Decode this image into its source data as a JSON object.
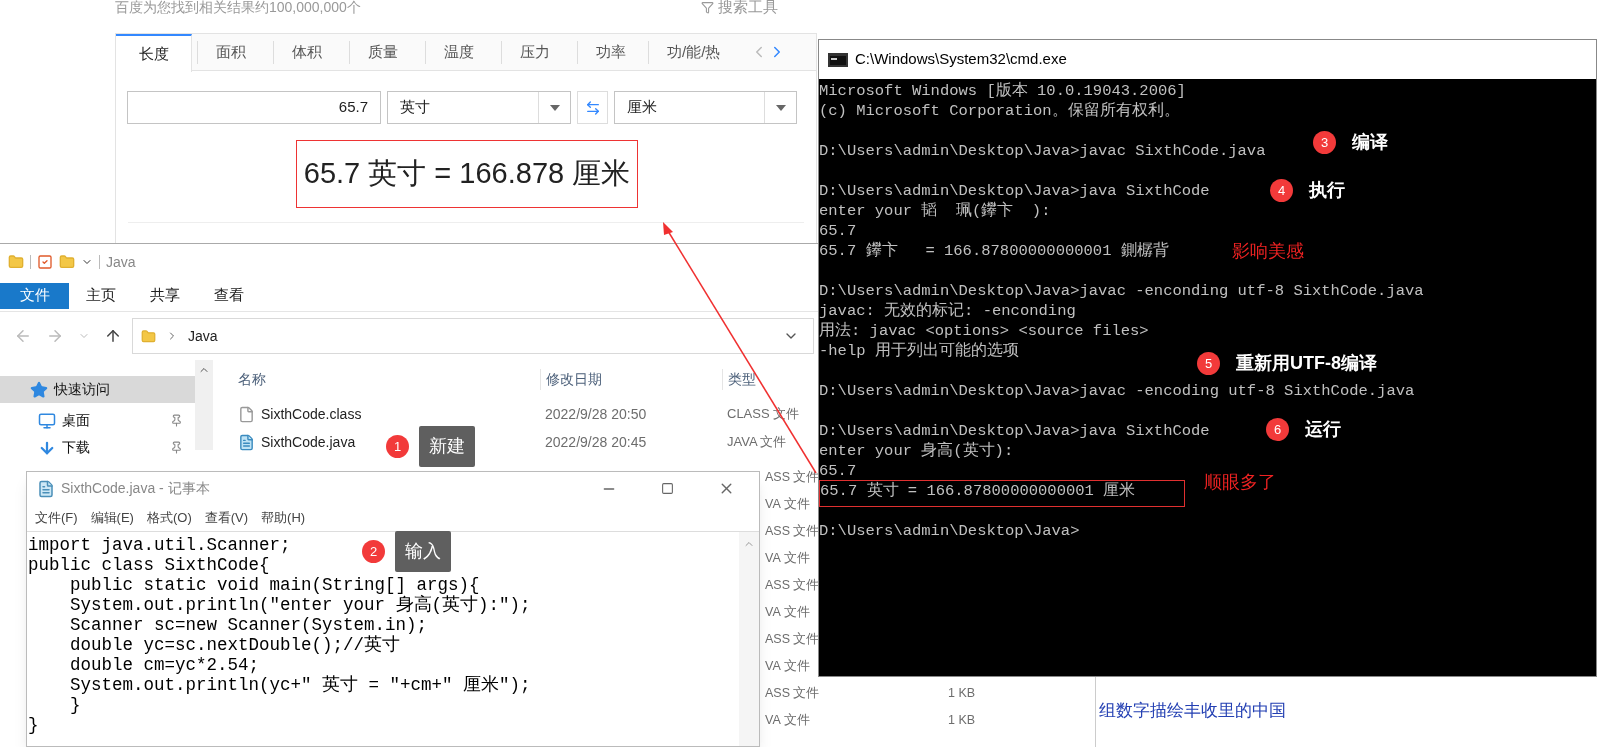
{
  "search_page": {
    "result_count": "百度为您找到相关结果约100,000,000个",
    "search_tools": "搜索工具",
    "converter": {
      "tabs": [
        {
          "label": "长度",
          "selected": true
        },
        {
          "label": "面积",
          "selected": false
        },
        {
          "label": "体积",
          "selected": false
        },
        {
          "label": "质量",
          "selected": false
        },
        {
          "label": "温度",
          "selected": false
        },
        {
          "label": "压力",
          "selected": false
        },
        {
          "label": "功率",
          "selected": false
        },
        {
          "label": "功/能/热",
          "selected": false
        }
      ],
      "value": "65.7",
      "from_unit": "英寸",
      "to_unit": "厘米",
      "result": "65.7 英寸 = 166.878 厘米"
    },
    "news_link": "组数字描绘丰收里的中国"
  },
  "explorer": {
    "title": "Java",
    "ribbon": {
      "file_button": "文件",
      "tabs": [
        "主页",
        "共享",
        "查看"
      ]
    },
    "address": "Java",
    "nav": [
      {
        "label": "快速访问",
        "kind": "star",
        "selected": true,
        "pinned": false
      },
      {
        "label": "桌面",
        "kind": "desktop",
        "selected": false,
        "pinned": true
      },
      {
        "label": "下载",
        "kind": "download",
        "selected": false,
        "pinned": true
      }
    ],
    "columns": [
      "名称",
      "修改日期",
      "类型"
    ],
    "files": [
      {
        "name": "SixthCode.class",
        "kind": "file",
        "modified": "2022/9/28 20:50",
        "type": "CLASS 文件"
      },
      {
        "name": "SixthCode.java",
        "kind": "java",
        "modified": "2022/9/28 20:45",
        "type": "JAVA 文件"
      }
    ],
    "hidden_rows": [
      {
        "type": "ASS 文件"
      },
      {
        "type": "VA 文件"
      },
      {
        "type": "ASS 文件"
      },
      {
        "type": "VA 文件"
      },
      {
        "type": "ASS 文件"
      },
      {
        "type": "VA 文件"
      },
      {
        "type": "ASS 文件"
      },
      {
        "type": "VA 文件"
      },
      {
        "type": "ASS 文件",
        "size": "1 KB"
      },
      {
        "type": "VA 文件",
        "size": "1 KB"
      }
    ]
  },
  "notepad": {
    "title": "SixthCode.java - 记事本",
    "menu": [
      "文件(F)",
      "编辑(E)",
      "格式(O)",
      "查看(V)",
      "帮助(H)"
    ],
    "lines": [
      "import java.util.Scanner;",
      "public class SixthCode{",
      "    public static void main(String[] args){",
      "    System.out.println(\"enter your 身高(英寸):\");",
      "    Scanner sc=new Scanner(System.in);",
      "    double yc=sc.nextDouble();//英寸",
      "    double cm=yc*2.54;",
      "    System.out.println(yc+\" 英寸 = \"+cm+\" 厘米\");",
      "    }",
      "}"
    ]
  },
  "console": {
    "title": "C:\\Windows\\System32\\cmd.exe",
    "blocks": [
      [
        {
          "text": "Microsoft Windows [版本 10.0.19043.2006]",
          "boxed": false
        },
        {
          "text": "(c) Microsoft Corporation。保留所有权利。",
          "boxed": false
        }
      ],
      [
        {
          "text": "D:\\Users\\admin\\Desktop\\Java>javac SixthCode.java",
          "boxed": false
        }
      ],
      [
        {
          "text": "D:\\Users\\admin\\Desktop\\Java>java SixthCode",
          "boxed": false
        },
        {
          "text": "enter your 韬  珮(鑻卞  ):",
          "boxed": false
        },
        {
          "text": "65.7",
          "boxed": false
        },
        {
          "text": "65.7 鑻卞   = 166.87800000000001 鍘樼背",
          "boxed": false
        }
      ],
      [
        {
          "text": "D:\\Users\\admin\\Desktop\\Java>javac -enconding utf-8 SixthCode.java",
          "boxed": false
        },
        {
          "text": "javac: 无效的标记: -enconding",
          "boxed": false
        },
        {
          "text": "用法: javac <options> <source files>",
          "boxed": false
        },
        {
          "text": "-help 用于列出可能的选项",
          "boxed": false
        }
      ],
      [
        {
          "text": "D:\\Users\\admin\\Desktop\\Java>javac -encoding utf-8 SixthCode.java",
          "boxed": false
        }
      ],
      [
        {
          "text": "D:\\Users\\admin\\Desktop\\Java>java SixthCode",
          "boxed": false
        },
        {
          "text": "enter your 身高(英寸):",
          "boxed": false
        },
        {
          "text": "65.7",
          "boxed": false
        },
        {
          "text": "65.7 英寸 = 166.87800000000001 厘米",
          "boxed": true
        }
      ],
      [
        {
          "text": "D:\\Users\\admin\\Desktop\\Java>",
          "boxed": false
        }
      ]
    ]
  },
  "annotations": [
    {
      "kind": "tooltip",
      "number": "1",
      "label": "新建"
    },
    {
      "kind": "tooltip",
      "number": "2",
      "label": "输入"
    },
    {
      "kind": "step",
      "number": "3",
      "label": "编译"
    },
    {
      "kind": "step",
      "number": "4",
      "label": "执行"
    },
    {
      "kind": "step",
      "number": "5",
      "label": "重新用UTF-8编译"
    },
    {
      "kind": "step",
      "number": "6",
      "label": "运行"
    },
    {
      "kind": "note",
      "label": "影响美感"
    },
    {
      "kind": "note",
      "label": "顺眼多了"
    }
  ]
}
